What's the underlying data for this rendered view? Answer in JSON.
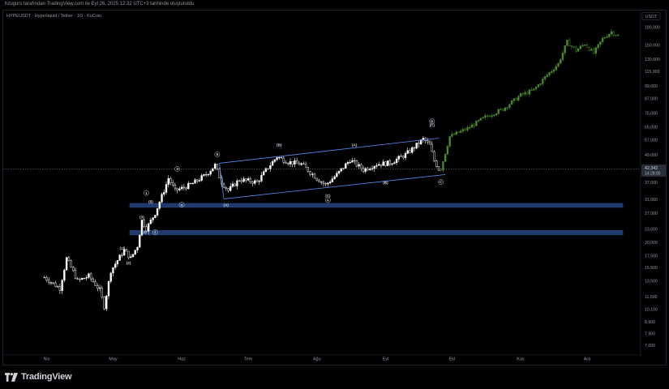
{
  "caption": "hzugurs tarafından TradingView.com ile Eyl 26, 2025 12:32 UTC+3 tarihinde oluşturuldu",
  "symbol_line": "HYPEUSDT · Hyperliquid / Tether · 1G · KuCoin",
  "brand": "TradingView",
  "colors": {
    "up": "#ffffff",
    "down": "#ffffff",
    "projection": "#4a8c2a",
    "channel": "#5b8df5",
    "zone": "#1f3a6b",
    "price_label": "#2a2e39"
  },
  "icons": {
    "logo": "tradingview-logo-icon"
  },
  "chart_data": {
    "type": "candlestick",
    "title": "",
    "currency": "USDT",
    "scale": "log",
    "ylim": [
      6.5,
      210
    ],
    "y_ticks": [
      {
        "v": 180,
        "label": "180,000"
      },
      {
        "v": 150,
        "label": "150,000"
      },
      {
        "v": 130,
        "label": "130,000"
      },
      {
        "v": 115,
        "label": "115,000"
      },
      {
        "v": 99,
        "label": "99,000"
      },
      {
        "v": 87,
        "label": "87,000"
      },
      {
        "v": 75,
        "label": "75,000"
      },
      {
        "v": 65,
        "label": "65,000"
      },
      {
        "v": 57,
        "label": "57,000"
      },
      {
        "v": 49,
        "label": "49,000"
      },
      {
        "v": 37,
        "label": "37,000"
      },
      {
        "v": 31,
        "label": "31,000"
      },
      {
        "v": 27,
        "label": "27,000"
      },
      {
        "v": 23,
        "label": "23,000"
      },
      {
        "v": 20,
        "label": "20,000"
      },
      {
        "v": 17.5,
        "label": "17,500"
      },
      {
        "v": 15.5,
        "label": "15,500"
      },
      {
        "v": 13.5,
        "label": "13,500"
      },
      {
        "v": 11.5,
        "label": "11,500"
      },
      {
        "v": 10.1,
        "label": "10,100"
      },
      {
        "v": 8.9,
        "label": "8,900"
      },
      {
        "v": 7.9,
        "label": "7,900"
      },
      {
        "v": 7.0,
        "label": "7,000"
      }
    ],
    "x_ticks": [
      "Nis",
      "May",
      "Haz",
      "Tem",
      "Ağu",
      "Eyl",
      "Ekl",
      "Kas",
      "Ara"
    ],
    "last_price": {
      "value": 42.342,
      "label": "42,342",
      "countdown": "14:28:00"
    },
    "support_zones": [
      {
        "low": 28.6,
        "high": 29.8
      },
      {
        "low": 21.6,
        "high": 22.6
      }
    ],
    "channel": {
      "upper": [
        {
          "d": "Haz 18",
          "v": 44.9
        },
        {
          "d": "Eyl 25",
          "v": 58.0
        }
      ],
      "lower": [
        {
          "d": "Haz 20",
          "v": 31.2
        },
        {
          "d": "Eyl 28",
          "v": 40.0
        }
      ]
    },
    "wave_labels": [
      {
        "text": "(1)",
        "d": "May 5",
        "v": 18.6
      },
      {
        "text": "(2)",
        "d": "May 8",
        "v": 16.0
      },
      {
        "text": "(3)",
        "d": "May 14",
        "v": 25.6
      },
      {
        "text": "(4)",
        "d": "May 15",
        "v": 21.9
      },
      {
        "text": "(5)",
        "d": "May 18",
        "v": 29.9
      },
      {
        "text": "1",
        "d": "May 16",
        "v": 32.7,
        "circled": true
      },
      {
        "text": "2",
        "d": "May 20",
        "v": 21.9,
        "circled": true
      },
      {
        "text": "3",
        "d": "May 30",
        "v": 41.8,
        "circled": true
      },
      {
        "text": "4",
        "d": "Haz 1",
        "v": 29.0,
        "circled": true
      },
      {
        "text": "5",
        "d": "Haz 17",
        "v": 48.5,
        "circled": true
      },
      {
        "text": "(A)",
        "d": "Haz 21",
        "v": 28.9
      },
      {
        "text": "(B)",
        "d": "Tem 15",
        "v": 53.5
      },
      {
        "text": "(C)",
        "d": "Ağu 6",
        "v": 31.8
      },
      {
        "text": "A",
        "d": "Ağu 6",
        "v": 30.4,
        "circled": true
      },
      {
        "text": "(A)",
        "d": "Ağu 18",
        "v": 53.4
      },
      {
        "text": "(B)",
        "d": "Eyl 1",
        "v": 36.4
      },
      {
        "text": "(C)",
        "d": "Eyl 22",
        "v": 65.5
      },
      {
        "text": "B",
        "d": "Eyl 22",
        "v": 68.0,
        "circled": true
      },
      {
        "text": "C",
        "d": "Eyl 26",
        "v": 36.6,
        "circled": true
      }
    ],
    "anchors": [
      {
        "d": "Mar 31",
        "v": 14.0
      },
      {
        "d": "Nis 7",
        "v": 12.5
      },
      {
        "d": "Nis 10",
        "v": 17.0
      },
      {
        "d": "Nis 15",
        "v": 13.5
      },
      {
        "d": "Nis 20",
        "v": 14.2
      },
      {
        "d": "Nis 25",
        "v": 12.3
      },
      {
        "d": "Nis 27",
        "v": 10.4
      },
      {
        "d": "Nis 30",
        "v": 15.0
      },
      {
        "d": "May 6",
        "v": 18.5
      },
      {
        "d": "May 9",
        "v": 17.0
      },
      {
        "d": "May 12",
        "v": 19.3
      },
      {
        "d": "May 14",
        "v": 25.0
      },
      {
        "d": "May 16",
        "v": 23.0
      },
      {
        "d": "May 20",
        "v": 27.0
      },
      {
        "d": "May 24",
        "v": 34.0
      },
      {
        "d": "May 26",
        "v": 38.5
      },
      {
        "d": "May 29",
        "v": 34.0
      },
      {
        "d": "Haz 2",
        "v": 35.0
      },
      {
        "d": "Haz 6",
        "v": 36.5
      },
      {
        "d": "Haz 12",
        "v": 40.0
      },
      {
        "d": "Haz 16",
        "v": 44.0
      },
      {
        "d": "Haz 19",
        "v": 37.0
      },
      {
        "d": "Haz 22",
        "v": 34.0
      },
      {
        "d": "Haz 27",
        "v": 38.0
      },
      {
        "d": "Tem 5",
        "v": 37.0
      },
      {
        "d": "Tem 10",
        "v": 43.0
      },
      {
        "d": "Tem 14",
        "v": 48.0
      },
      {
        "d": "Tem 19",
        "v": 45.5
      },
      {
        "d": "Tem 25",
        "v": 44.5
      },
      {
        "d": "Ağu 1",
        "v": 38.5
      },
      {
        "d": "Ağu 5",
        "v": 36.0
      },
      {
        "d": "Ağu 10",
        "v": 40.0
      },
      {
        "d": "Ağu 16",
        "v": 46.5
      },
      {
        "d": "Ağu 22",
        "v": 42.0
      },
      {
        "d": "Ağu 28",
        "v": 44.5
      },
      {
        "d": "Eyl 3",
        "v": 45.0
      },
      {
        "d": "Eyl 10",
        "v": 49.0
      },
      {
        "d": "Eyl 15",
        "v": 54.0
      },
      {
        "d": "Eyl 18",
        "v": 57.5
      },
      {
        "d": "Eyl 21",
        "v": 54.0
      },
      {
        "d": "Eyl 23",
        "v": 46.0
      },
      {
        "d": "Eyl 25",
        "v": 42.3
      }
    ],
    "projection_anchors": [
      {
        "d": "Eyl 26",
        "v": 42.3
      },
      {
        "d": "Eyl 30",
        "v": 59.0
      },
      {
        "d": "Eki 8",
        "v": 64.0
      },
      {
        "d": "Eki 16",
        "v": 72.0
      },
      {
        "d": "Eki 24",
        "v": 78.0
      },
      {
        "d": "Kas 1",
        "v": 90.0
      },
      {
        "d": "Kas 7",
        "v": 95.0
      },
      {
        "d": "Kas 12",
        "v": 108.0
      },
      {
        "d": "Kas 18",
        "v": 124.0
      },
      {
        "d": "Kas 22",
        "v": 155.0
      },
      {
        "d": "Kas 26",
        "v": 142.0
      },
      {
        "d": "Kas 30",
        "v": 152.0
      },
      {
        "d": "Ara 4",
        "v": 138.0
      },
      {
        "d": "Ara 8",
        "v": 160.0
      },
      {
        "d": "Ara 12",
        "v": 172.0
      },
      {
        "d": "Ara 15",
        "v": 165.0
      }
    ]
  }
}
